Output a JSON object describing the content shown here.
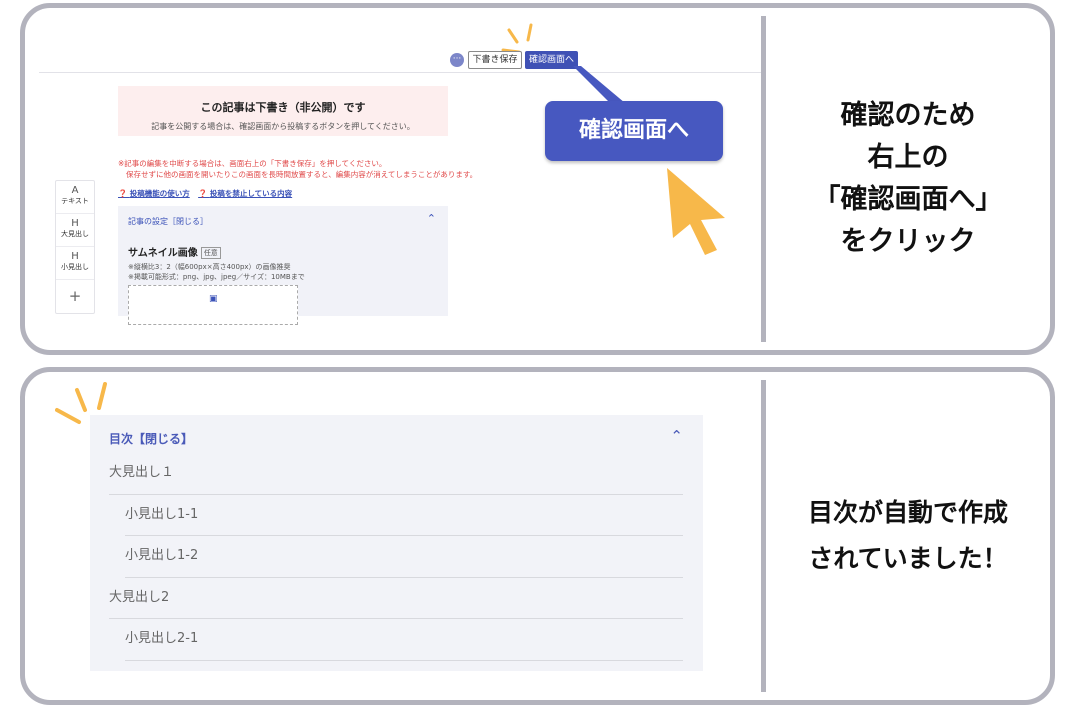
{
  "panel1": {
    "toolbar": {
      "more_label": "···",
      "draft_save_label": "下書き保存",
      "confirm_label": "確認画面へ"
    },
    "notice": {
      "title": "この記事は下書き（非公開）です",
      "subtitle": "記事を公開する場合は、確認画面から投稿するボタンを押してください。"
    },
    "warning": {
      "line1": "※記事の編集を中断する場合は、画面右上の「下書き保存」を押してください。",
      "line2": "保存せずに他の画面を開いたりこの画面を長時間放置すると、編集内容が消えてしまうことがあります。"
    },
    "help_links": [
      "投稿機能の使い方",
      "投稿を禁止している内容"
    ],
    "settings": {
      "header": "記事の設定［閉じる］",
      "thumbnail_title": "サムネイル画像",
      "thumbnail_tag": "任意",
      "note1": "※縦横比3：2（幅600px×高さ400px）の画像推奨",
      "note2": "※掲載可能形式：png、jpg、jpeg／サイズ：10MBまで"
    },
    "left_tools": [
      {
        "glyph": "A",
        "label": "テキスト"
      },
      {
        "glyph": "H",
        "label": "大見出し"
      },
      {
        "glyph": "H",
        "label": "小見出し"
      }
    ],
    "add_tool": "+",
    "zoomed_button_label": "確認画面へ",
    "caption_lines": [
      "確認のため",
      "右上の",
      "「確認画面へ」",
      "をクリック"
    ],
    "accent_color": "#4758c0",
    "cursor_color": "#f7b84a"
  },
  "panel2": {
    "toc": {
      "header": "目次【閉じる】",
      "items": [
        {
          "label": "大見出し１",
          "level": 1
        },
        {
          "label": "小見出し1-1",
          "level": 2
        },
        {
          "label": "小見出し1-2",
          "level": 2
        },
        {
          "label": "大見出し2",
          "level": 1
        },
        {
          "label": "小見出し2-1",
          "level": 2
        }
      ]
    },
    "caption_lines": [
      "目次が自動で作成",
      "されていました！"
    ]
  }
}
